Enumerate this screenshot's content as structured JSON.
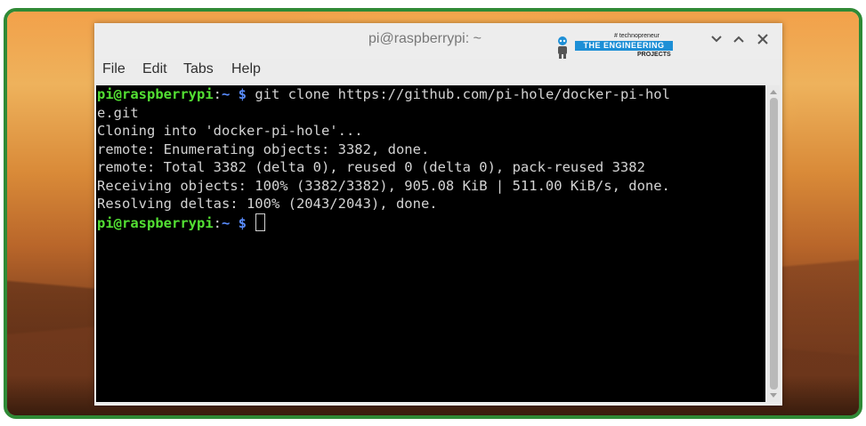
{
  "window": {
    "title": "pi@raspberrypi: ~"
  },
  "watermark": {
    "tagline": "# technopreneur",
    "name": "THE ENGINEERING",
    "subtitle": "PROJECTS"
  },
  "menu": [
    {
      "label": "File"
    },
    {
      "label": "Edit"
    },
    {
      "label": "Tabs"
    },
    {
      "label": "Help"
    }
  ],
  "icons": {
    "minimize": "chevron-down-icon",
    "maximize": "chevron-up-icon",
    "close": "close-icon"
  },
  "colors": {
    "frame_border": "#2f8a36",
    "terminal_bg": "#000000",
    "terminal_fg": "#d3d3d3",
    "prompt_user": "#53e033",
    "prompt_path": "#5a8dff"
  },
  "terminal": {
    "prompt_user": "pi@raspberrypi",
    "prompt_colon": ":",
    "prompt_path": "~",
    "prompt_dollar": " $",
    "command": " git clone https://github.com/pi-hole/docker-pi-hol",
    "command_wrap": "e.git",
    "output": [
      "Cloning into 'docker-pi-hole'...",
      "remote: Enumerating objects: 3382, done.",
      "remote: Total 3382 (delta 0), reused 0 (delta 0), pack-reused 3382",
      "Receiving objects: 100% (3382/3382), 905.08 KiB | 511.00 KiB/s, done.",
      "Resolving deltas: 100% (2043/2043), done."
    ]
  }
}
